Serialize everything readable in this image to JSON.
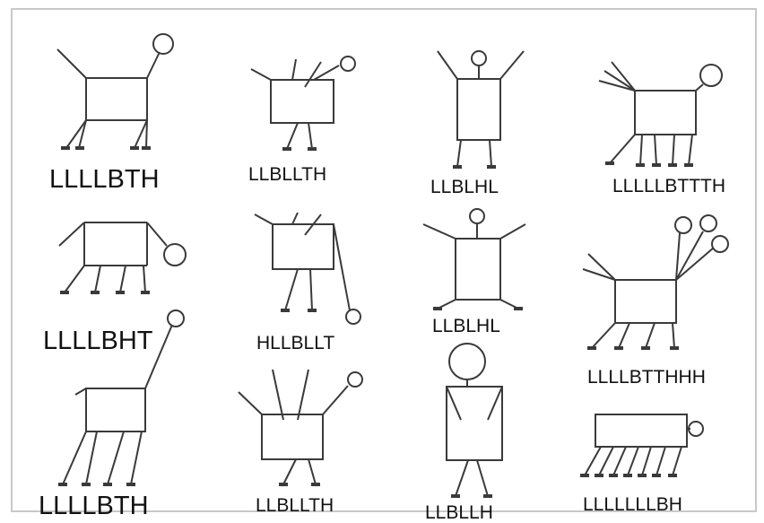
{
  "figure": {
    "labels": [
      "LLLLBTH",
      "LLBLLTH",
      "LLBLHL",
      "LLLLLBTTTH",
      "LLLLBHT",
      "HLLBLLT",
      "LLBLHL",
      "LLLLBTTHHH",
      "LLLLBTH",
      "LLBLLTH",
      "LLBLLH",
      "LLLLLLLBH"
    ]
  }
}
